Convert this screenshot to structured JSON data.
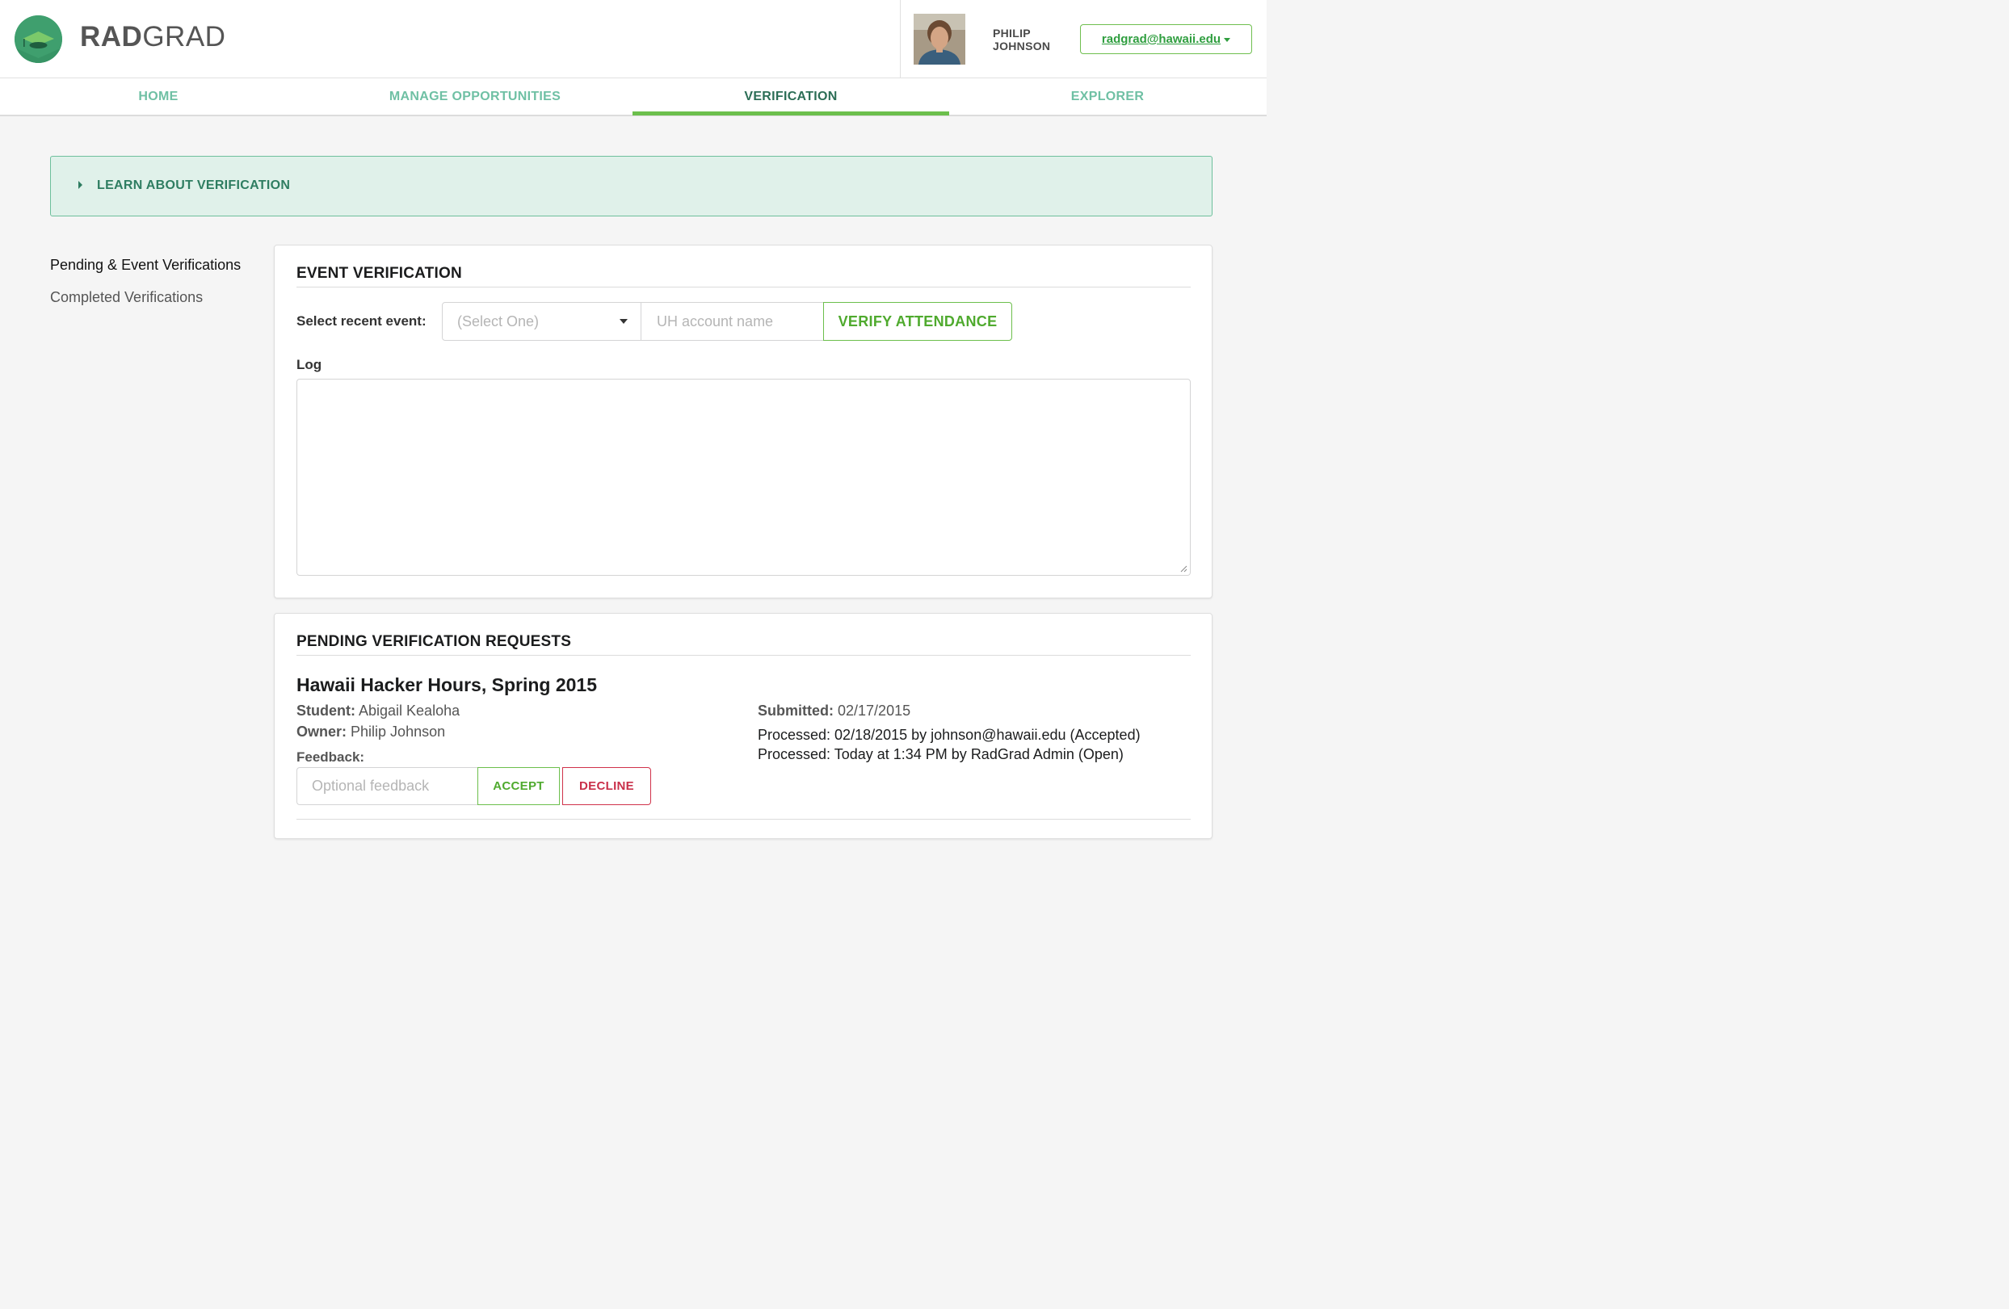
{
  "brand": {
    "name_bold": "RAD",
    "name_light": "GRAD",
    "logo_icon": "graduation-cap-icon"
  },
  "user": {
    "first_name": "PHILIP",
    "last_name": "JOHNSON",
    "account_label": "radgrad@hawaii.edu"
  },
  "nav": {
    "tabs": [
      {
        "label": "HOME",
        "active": false
      },
      {
        "label": "MANAGE OPPORTUNITIES",
        "active": false
      },
      {
        "label": "VERIFICATION",
        "active": true
      },
      {
        "label": "EXPLORER",
        "active": false
      }
    ]
  },
  "learn": {
    "label": "LEARN ABOUT VERIFICATION"
  },
  "side_menu": {
    "items": [
      "Pending & Event Verifications",
      "Completed Verifications"
    ],
    "active_index": 0
  },
  "event_verification": {
    "title": "EVENT VERIFICATION",
    "select_label": "Select recent event:",
    "select_placeholder": "(Select One)",
    "account_placeholder": "UH account name",
    "verify_button": "VERIFY ATTENDANCE",
    "log_label": "Log",
    "log_value": ""
  },
  "pending": {
    "title": "PENDING VERIFICATION REQUESTS",
    "request": {
      "name": "Hawaii Hacker Hours, Spring 2015",
      "student_label": "Student:",
      "student": "Abigail Kealoha",
      "owner_label": "Owner:",
      "owner": "Philip Johnson",
      "feedback_label": "Feedback:",
      "feedback_placeholder": "Optional feedback",
      "submitted_label": "Submitted:",
      "submitted": "02/17/2015",
      "processed": [
        "Processed: 02/18/2015 by johnson@hawaii.edu (Accepted)",
        "Processed: Today at 1:34 PM by RadGrad Admin (Open)"
      ],
      "accept_button": "ACCEPT",
      "decline_button": "DECLINE"
    }
  },
  "colors": {
    "accent_green": "#6cbf4c",
    "teal": "#6fc0a4",
    "teal_dark": "#2c6e56",
    "banner_bg": "#e0f1ea",
    "decline_red": "#c9304a"
  }
}
